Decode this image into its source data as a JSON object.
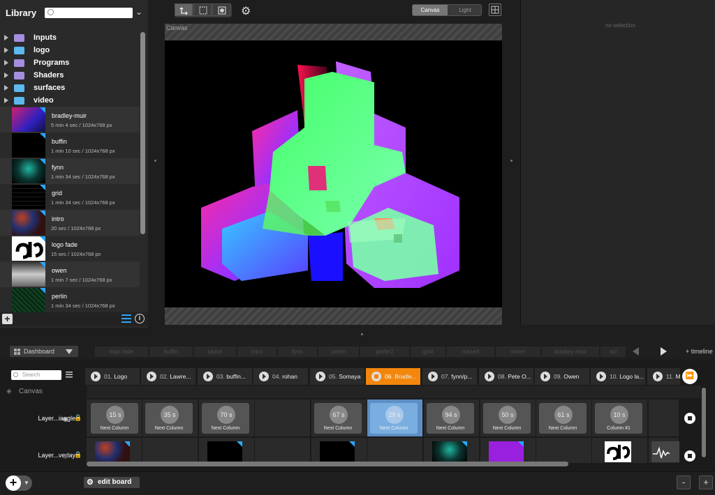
{
  "library": {
    "title": "Library",
    "search_placeholder": "",
    "folders": [
      {
        "label": "Inputs",
        "color": "#a58ee0"
      },
      {
        "label": "logo",
        "color": "#5cb8ef"
      },
      {
        "label": "Programs",
        "color": "#a58ee0"
      },
      {
        "label": "Shaders",
        "color": "#a58ee0"
      },
      {
        "label": "surfaces",
        "color": "#5cb8ef"
      },
      {
        "label": "video",
        "color": "#5cb8ef"
      }
    ],
    "media": [
      {
        "name": "bradley-muir",
        "meta": "5 min 4 sec / 1024x768 px"
      },
      {
        "name": "buffin",
        "meta": "1 min 10 sec / 1024x768 px"
      },
      {
        "name": "fynn",
        "meta": "1 min 34 sec / 1024x768 px"
      },
      {
        "name": "grid",
        "meta": "1 min 34 sec / 1024x768 px"
      },
      {
        "name": "intro",
        "meta": "20 sec / 1024x768 px"
      },
      {
        "name": "logo fade",
        "meta": "15 sec / 1024x768 px"
      },
      {
        "name": "owen",
        "meta": "1 min 7 sec / 1024x768 px"
      },
      {
        "name": "perlin",
        "meta": "1 min 34 sec / 1024x768 px"
      }
    ],
    "add_label": "+",
    "info_label": "i"
  },
  "toolbar": {
    "segment_on": "Canvas",
    "segment_off": "Light"
  },
  "canvas": {
    "label": "Canvas"
  },
  "inspector": {
    "empty_text": "no selection"
  },
  "dashboard": {
    "tab_label": "Dashboard",
    "presets": [
      "logo fade",
      "buffin",
      "taylor",
      "intro",
      "fynn",
      "perlin",
      "perlin2",
      "grid",
      "russell",
      "owen",
      "bradley-muir",
      "sci"
    ],
    "add_timeline": "+ timeline"
  },
  "board": {
    "search_placeholder": "Search",
    "columns": [
      {
        "num": "01.",
        "name": "Logo"
      },
      {
        "num": "02.",
        "name": "Lawre..."
      },
      {
        "num": "03.",
        "name": "buffin..."
      },
      {
        "num": "04.",
        "name": "rohan"
      },
      {
        "num": "05.",
        "name": "Somaya"
      },
      {
        "num": "06.",
        "name": "Bradle..."
      },
      {
        "num": "07.",
        "name": "fynn/p..."
      },
      {
        "num": "08.",
        "name": "Pete O..."
      },
      {
        "num": "09.",
        "name": "Owen"
      },
      {
        "num": "10.",
        "name": "Logo la..."
      },
      {
        "num": "11.",
        "name": "M"
      }
    ],
    "group_label": "Canvas",
    "layers": [
      {
        "name": "Layer...iangle"
      },
      {
        "name": "Layer...verlay"
      }
    ],
    "timers": [
      {
        "value": "15 s",
        "caption": "Next Column"
      },
      {
        "value": "35 s",
        "caption": "Next Column"
      },
      {
        "value": "70 s",
        "caption": "Next Column"
      },
      {
        "value": "67 s",
        "caption": "Next Column"
      },
      {
        "value": "29 s",
        "caption": "Next Column"
      },
      {
        "value": "94 s",
        "caption": "Next Column"
      },
      {
        "value": "50 s",
        "caption": "Next Column"
      },
      {
        "value": "61 s",
        "caption": "Next Column"
      },
      {
        "value": "10 s",
        "caption": "Column #1"
      }
    ]
  },
  "bottom": {
    "edit_board": "edit board",
    "zoom_out": "-",
    "zoom_in": "+"
  }
}
